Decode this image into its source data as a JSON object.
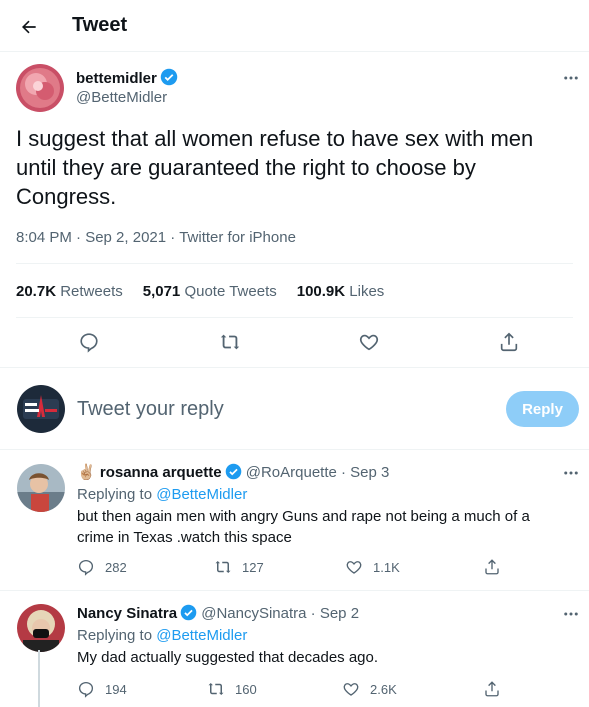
{
  "header": {
    "title": "Tweet"
  },
  "main_tweet": {
    "display_name": "bettemidler",
    "handle": "@BetteMidler",
    "text": "I suggest that all women refuse to have sex with men until they are guaranteed the right to choose by Congress.",
    "time": "8:04 PM · Sep 2, 2021",
    "separator": "·",
    "source": "Twitter for iPhone",
    "stats": {
      "retweets_count": "20.7K",
      "retweets_label": "Retweets",
      "quotes_count": "5,071",
      "quotes_label": "Quote Tweets",
      "likes_count": "100.9K",
      "likes_label": "Likes"
    }
  },
  "compose": {
    "placeholder": "Tweet your reply",
    "button_label": "Reply"
  },
  "replies": [
    {
      "emoji": "✌🏼",
      "display_name": "rosanna arquette",
      "handle": "@RoArquette",
      "date": "· Sep 3",
      "replying_prefix": "Replying to",
      "replying_to": "@BetteMidler",
      "text": "but then again men with angry Guns and rape not being a much of a crime in Texas .watch this space",
      "reply_count": "282",
      "retweet_count": "127",
      "like_count": "1.1K"
    },
    {
      "display_name": "Nancy Sinatra",
      "handle": "@NancySinatra",
      "date": "· Sep 2",
      "replying_prefix": "Replying to",
      "replying_to": "@BetteMidler",
      "text": "My dad actually suggested that decades ago.",
      "reply_count": "194",
      "retweet_count": "160",
      "like_count": "2.6K"
    }
  ],
  "colors": {
    "accent": "#1d9bf0",
    "muted": "#536471",
    "reply_button_disabled": "#8ecdf8"
  }
}
